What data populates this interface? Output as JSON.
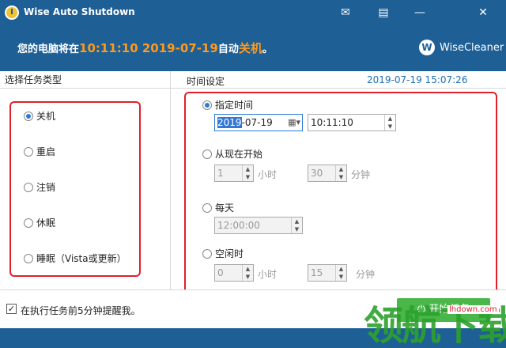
{
  "window": {
    "title": "Wise Auto Shutdown",
    "icons": [
      "mail-icon",
      "message-icon",
      "minimize-icon",
      "close-icon"
    ]
  },
  "banner": {
    "prefix": "您的电脑将在",
    "time": "10:11:10 2019-07-19",
    "mid": "自动",
    "action": "关机",
    "suffix": "。",
    "brand": "WiseCleaner",
    "brand_logo": "W"
  },
  "task_panel": {
    "header": "选择任务类型",
    "options": [
      {
        "label": "关机",
        "selected": true
      },
      {
        "label": "重启",
        "selected": false
      },
      {
        "label": "注销",
        "selected": false
      },
      {
        "label": "休眠",
        "selected": false
      },
      {
        "label": "睡眠（Vista或更新）",
        "selected": false
      }
    ]
  },
  "time_panel": {
    "header": "时间设定",
    "current_datetime": "2019-07-19 15:07:26",
    "specified": {
      "label": "指定时间",
      "selected": true,
      "date_year": "2019",
      "date_rest": "-07-19",
      "time": "10:11:10"
    },
    "from_now": {
      "label": "从现在开始",
      "selected": false,
      "hours": "1",
      "hours_unit": "小时",
      "minutes": "30",
      "minutes_unit": "分钟"
    },
    "daily": {
      "label": "每天",
      "selected": false,
      "time": "12:00:00"
    },
    "idle": {
      "label": "空闲时",
      "selected": false,
      "hours": "0",
      "hours_unit": "小时",
      "minutes": "15",
      "minutes_unit": "分钟"
    }
  },
  "bottom": {
    "reminder_label": "在执行任务前5分钟提醒我。",
    "reminder_checked": true,
    "start_label": "开始任务"
  },
  "watermark": {
    "text": "领航下载",
    "url": "lhdown.com"
  },
  "colors": {
    "brand_blue": "#1e5f96",
    "highlight_orange": "#ff9a1a",
    "annotation_red": "#e0202a",
    "start_green": "#49b749"
  }
}
